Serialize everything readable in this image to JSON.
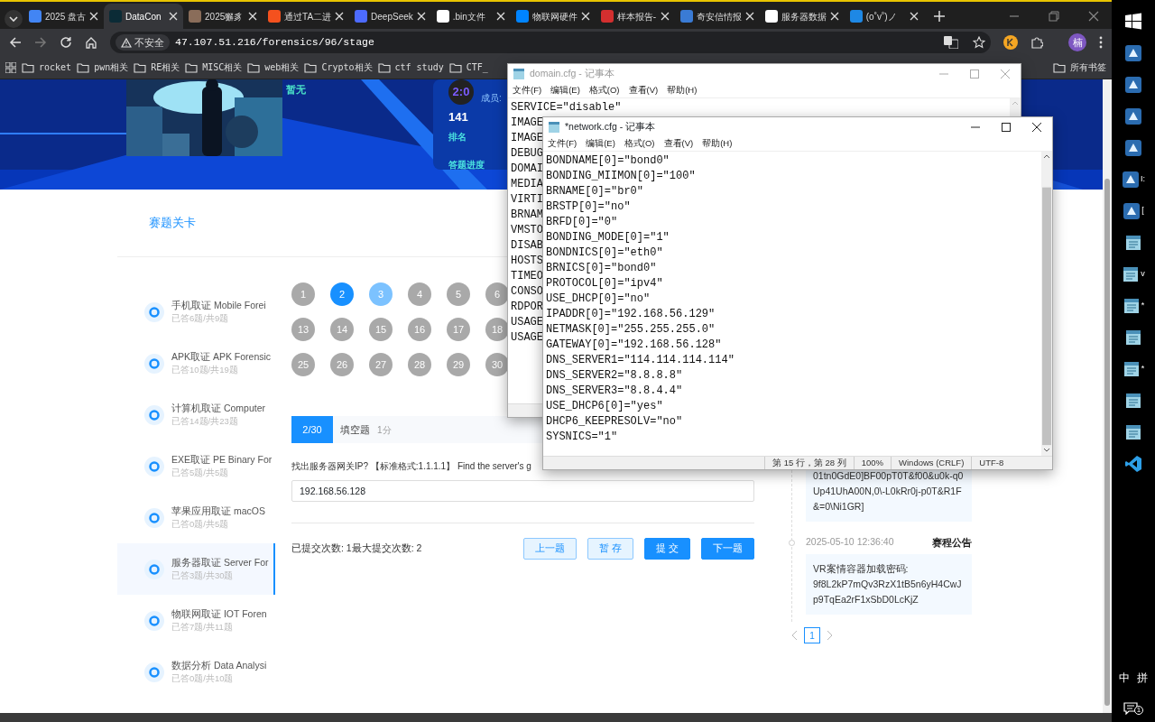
{
  "browser": {
    "tabs": [
      {
        "label": "2025 盘古",
        "selected": false
      },
      {
        "label": "DataCon",
        "selected": true
      },
      {
        "label": "2025獬豸",
        "selected": false
      },
      {
        "label": "通过TA二进",
        "selected": false
      },
      {
        "label": "DeepSeek",
        "selected": false
      },
      {
        "label": ".bin文件",
        "selected": false
      },
      {
        "label": "物联网硬件",
        "selected": false
      },
      {
        "label": "样本报告-",
        "selected": false
      },
      {
        "label": "奇安信情报",
        "selected": false
      },
      {
        "label": "服务器数据",
        "selected": false
      },
      {
        "label": "(o˚v˚)ノ",
        "selected": false
      }
    ],
    "security": "不安全",
    "url": "47.107.51.216/forensics/96/stage",
    "profile_initial": "楠",
    "bookmarks": [
      "rocket",
      "pwn相关",
      "RE相关",
      "MISC相关",
      "web相关",
      "Crypto相关",
      "ctf study",
      "CTF_"
    ],
    "all_bookmarks": "所有书签"
  },
  "banner": {
    "no_data": "暂无",
    "score_badge": "2:0",
    "members_label": "成员:",
    "rank": "141",
    "rank_label": "排名",
    "progress_label": "答题进度"
  },
  "stage_title": "赛题关卡",
  "categories": [
    {
      "name": "手机取证 Mobile Forei",
      "progress": "已答6题/共9题",
      "selected": false
    },
    {
      "name": "APK取证 APK Forensic",
      "progress": "已答10题/共19题",
      "selected": false
    },
    {
      "name": "计算机取证 Computer",
      "progress": "已答14题/共23题",
      "selected": false
    },
    {
      "name": "EXE取证 PE Binary For",
      "progress": "已答5题/共5题",
      "selected": false
    },
    {
      "name": "苹果应用取证 macOS",
      "progress": "已答0题/共5题",
      "selected": false
    },
    {
      "name": "服务器取证 Server For",
      "progress": "已答3题/共30题",
      "selected": true
    },
    {
      "name": "物联网取证 IOT Foren",
      "progress": "已答7题/共11题",
      "selected": false
    },
    {
      "name": "数据分析 Data Analysi",
      "progress": "已答0题/共10题",
      "selected": false
    }
  ],
  "question_grid": [
    [
      {
        "label": "1",
        "selected": false,
        "visited": false
      },
      {
        "label": "2",
        "selected": true,
        "visited": false
      },
      {
        "label": "3",
        "selected": false,
        "visited": true
      },
      {
        "label": "4",
        "selected": false,
        "visited": false
      },
      {
        "label": "5",
        "selected": false,
        "visited": false
      },
      {
        "label": "6",
        "selected": false,
        "visited": false
      }
    ],
    [
      {
        "label": "13",
        "selected": false,
        "visited": false
      },
      {
        "label": "14",
        "selected": false,
        "visited": false
      },
      {
        "label": "15",
        "selected": false,
        "visited": false
      },
      {
        "label": "16",
        "selected": false,
        "visited": false
      },
      {
        "label": "17",
        "selected": false,
        "visited": false
      },
      {
        "label": "18",
        "selected": false,
        "visited": false
      }
    ],
    [
      {
        "label": "25",
        "selected": false,
        "visited": false
      },
      {
        "label": "26",
        "selected": false,
        "visited": false
      },
      {
        "label": "27",
        "selected": false,
        "visited": false
      },
      {
        "label": "28",
        "selected": false,
        "visited": false
      },
      {
        "label": "29",
        "selected": false,
        "visited": false
      },
      {
        "label": "30",
        "selected": false,
        "visited": false
      }
    ]
  ],
  "question": {
    "index": "2/30",
    "type": "填空题",
    "points": "1分",
    "text": "找出服务器网关IP? 【标准格式:1.1.1.1】 Find the server's g",
    "answer": "192.168.56.128",
    "submissions": "已提交次数: 1最大提交次数: 2",
    "buttons": [
      {
        "label": "上一题",
        "kind": "secondary"
      },
      {
        "label": "暂 存",
        "kind": "secondary"
      },
      {
        "label": "提 交",
        "kind": "primary"
      },
      {
        "label": "下一题",
        "kind": "primary"
      }
    ]
  },
  "announcements": [
    {
      "body": "01tn0GdE0]BF00pT0T&f00&u0k-q0Up41UhA00N,0\\-L0kRr0j-p0T&R1F&=0\\Ni1GR]"
    },
    {
      "time": "2025-05-10 12:36:40",
      "title": "赛程公告",
      "body": "VR案情容器加载密码:\n9f8L2kP7mQv3RzX1tB5n6yH4CwJp9TqEa2rF1xSbD0LcKjZ"
    }
  ],
  "pagination": [
    {
      "label": "1",
      "selected": true
    }
  ],
  "notepads": [
    {
      "title": "domain.cfg - 记事本",
      "active": false,
      "menu": [
        "文件(F)",
        "编辑(E)",
        "格式(O)",
        "查看(V)",
        "帮助(H)"
      ],
      "lines": [
        "SERVICE=\"disable\"",
        "IMAGE",
        "IMAGE",
        "DEBUG",
        "DOMAI",
        "MEDIA",
        "VIRTI",
        "BRNAM",
        "VMSTO",
        "DISAB",
        "HOSTS",
        "TIMEO",
        "CONSO",
        "RDPOR",
        "USAGE",
        "USAGE"
      ]
    },
    {
      "title": "*network.cfg - 记事本",
      "active": true,
      "menu": [
        "文件(F)",
        "编辑(E)",
        "格式(O)",
        "查看(V)",
        "帮助(H)"
      ],
      "lines": [
        "BONDNAME[0]=\"bond0\"",
        "BONDING_MIIMON[0]=\"100\"",
        "BRNAME[0]=\"br0\"",
        "BRSTP[0]=\"no\"",
        "BRFD[0]=\"0\"",
        "BONDING_MODE[0]=\"1\"",
        "BONDNICS[0]=\"eth0\"",
        "BRNICS[0]=\"bond0\"",
        "PROTOCOL[0]=\"ipv4\"",
        "USE_DHCP[0]=\"no\"",
        "IPADDR[0]=\"192.168.56.129\"",
        "NETMASK[0]=\"255.255.255.0\"",
        "GATEWAY[0]=\"192.168.56.128\"",
        "DNS_SERVER1=\"114.114.114.114\"",
        "DNS_SERVER2=\"8.8.8.8\"",
        "DNS_SERVER3=\"8.8.4.4\"",
        "USE_DHCP6[0]=\"yes\"",
        "DHCP6_KEEPRESOLV=\"no\"",
        "SYSNICS=\"1\""
      ],
      "status": [
        "第 15 行，第 28 列",
        "100%",
        "Windows (CRLF)",
        "UTF-8"
      ]
    }
  ],
  "taskbar": {
    "items": [
      {
        "kind": "start"
      },
      {
        "kind": "app"
      },
      {
        "kind": "app"
      },
      {
        "kind": "app"
      },
      {
        "kind": "app"
      },
      {
        "kind": "app",
        "label": "I:"
      },
      {
        "kind": "app",
        "label": "["
      },
      {
        "kind": "notepad"
      },
      {
        "kind": "notepad",
        "label": "v"
      },
      {
        "kind": "notepad",
        "label": "*"
      },
      {
        "kind": "notepad"
      },
      {
        "kind": "notepad",
        "label": "*"
      },
      {
        "kind": "notepad"
      },
      {
        "kind": "notepad"
      },
      {
        "kind": "code"
      }
    ],
    "ime": [
      "中",
      "拼"
    ],
    "notifications": "1"
  }
}
